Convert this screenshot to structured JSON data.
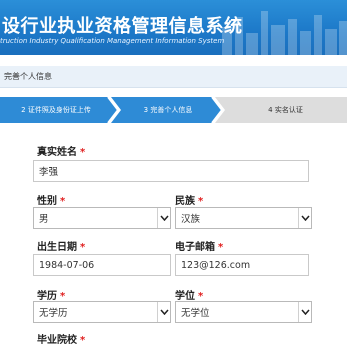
{
  "header": {
    "title": "设行业执业资格管理信息系统",
    "subtitle": "truction Industry Qualification Management Information System"
  },
  "breadcrumb": {
    "current": "完善个人信息"
  },
  "steps": [
    {
      "label": "2 证件照及身份证上传",
      "state": "done"
    },
    {
      "label": "3 完善个人信息",
      "state": "done"
    },
    {
      "label": "4 实名认证",
      "state": "todo"
    }
  ],
  "form": {
    "real_name": {
      "label": "真实姓名",
      "required": "*",
      "value": "李强"
    },
    "gender": {
      "label": "性别",
      "required": "*",
      "value": "男"
    },
    "ethnicity": {
      "label": "民族",
      "required": "*",
      "value": "汉族"
    },
    "birth_date": {
      "label": "出生日期",
      "required": "*",
      "value": "1984-07-06"
    },
    "email": {
      "label": "电子邮箱",
      "required": "*",
      "value": "123@126.com"
    },
    "education": {
      "label": "学历",
      "required": "*",
      "value": "无学历"
    },
    "degree": {
      "label": "学位",
      "required": "*",
      "value": "无学位"
    },
    "school": {
      "label": "毕业院校",
      "required": "*"
    }
  },
  "colors": {
    "header_blue": "#1c78c8",
    "step_done": "#2e8bd6",
    "step_todo": "#dddddd",
    "required": "#e02020"
  }
}
